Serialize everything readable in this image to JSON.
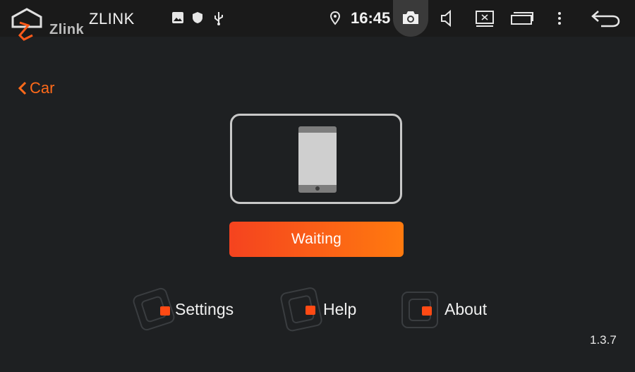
{
  "statusbar": {
    "app_title": "ZLINK",
    "logo_text": "Zlink",
    "time": "16:45",
    "icons": [
      "home-icon",
      "image-icon",
      "shield-icon",
      "usb-icon",
      "location-icon",
      "camera-icon",
      "volume-icon",
      "screen-off-icon",
      "recent-apps-icon",
      "more-vert-icon",
      "back-arrow-icon"
    ]
  },
  "nav": {
    "back_label": "Car"
  },
  "device": {
    "icon": "phone-icon"
  },
  "status_button": {
    "label": "Waiting"
  },
  "menu": {
    "settings_label": "Settings",
    "help_label": "Help",
    "about_label": "About"
  },
  "version": "1.3.7",
  "colors": {
    "accent": "#ff6a1a",
    "background": "#1e2022",
    "statusbar": "#1a1a1a"
  }
}
